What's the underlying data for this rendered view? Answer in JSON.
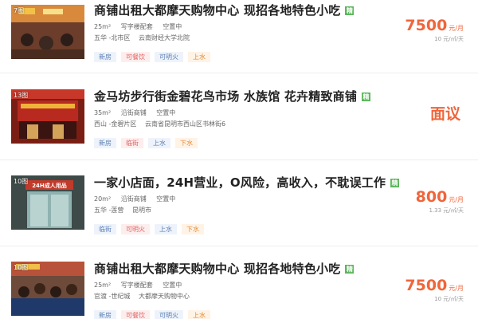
{
  "listings": [
    {
      "photo_count": "7图",
      "title": "商铺出租大都摩天购物中心 现招各地特色小吃",
      "verified_label": "精",
      "area": "25m²",
      "features": [
        "写字楼配套",
        "空置中"
      ],
      "district": "五华 -北市区",
      "address": "云南财经大学北院",
      "tags": [
        {
          "label": "新房",
          "color": "blue"
        },
        {
          "label": "可餐饮",
          "color": "red"
        },
        {
          "label": "可明火",
          "color": "blue"
        },
        {
          "label": "上水",
          "color": "orange"
        }
      ],
      "price": "7500",
      "price_unit": "元/月",
      "unit_price": "10 元/㎡/天"
    },
    {
      "photo_count": "13图",
      "title": "金马坊步行街金碧花鸟市场 水族馆 花卉精致商铺",
      "verified_label": "精",
      "area": "35m²",
      "features": [
        "沿街商铺",
        "空置中"
      ],
      "district": "西山 -金碧片区",
      "address": "云南省昆明市西山区书林街6",
      "tags": [
        {
          "label": "新房",
          "color": "blue"
        },
        {
          "label": "临街",
          "color": "red"
        },
        {
          "label": "上水",
          "color": "blue"
        },
        {
          "label": "下水",
          "color": "orange"
        }
      ],
      "price_negotiable": "面议"
    },
    {
      "photo_count": "10图",
      "title": "一家小店面，24H营业，O风险，高收入，不耽误工作",
      "verified_label": "精",
      "area": "20m²",
      "features": [
        "沿街商铺",
        "空置中"
      ],
      "district": "五华 -莲营",
      "address": "昆明市",
      "tags": [
        {
          "label": "临街",
          "color": "blue"
        },
        {
          "label": "可明火",
          "color": "red"
        },
        {
          "label": "上水",
          "color": "blue"
        },
        {
          "label": "下水",
          "color": "orange"
        }
      ],
      "price": "800",
      "price_unit": "元/月",
      "unit_price": "1.33 元/㎡/天"
    },
    {
      "photo_count": "10图",
      "title": "商铺出租大都摩天购物中心 现招各地特色小吃",
      "verified_label": "精",
      "area": "25m²",
      "features": [
        "写字楼配套",
        "空置中"
      ],
      "district": "官渡 -世纪城",
      "address": "大都摩天购物中心",
      "tags": [
        {
          "label": "新房",
          "color": "blue"
        },
        {
          "label": "可餐饮",
          "color": "red"
        },
        {
          "label": "可明火",
          "color": "blue"
        },
        {
          "label": "上水",
          "color": "orange"
        }
      ],
      "price": "7500",
      "price_unit": "元/月",
      "unit_price": "10 元/㎡/天"
    }
  ]
}
